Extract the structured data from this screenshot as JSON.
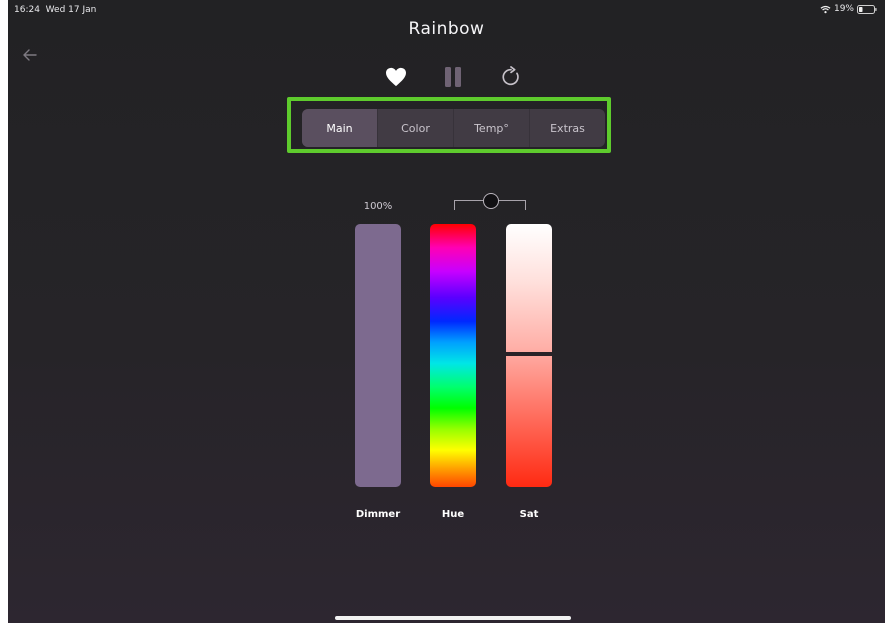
{
  "status": {
    "time": "16:24",
    "date": "Wed 17 Jan",
    "battery": "19%"
  },
  "header": {
    "title": "Rainbow"
  },
  "controls": {
    "favorite_icon": "heart-icon",
    "pause_icon": "pause-icon",
    "reload_icon": "reload-icon"
  },
  "tabs": [
    {
      "label": "Main",
      "active": true
    },
    {
      "label": "Color",
      "active": false
    },
    {
      "label": "Temp°",
      "active": false
    },
    {
      "label": "Extras",
      "active": false
    }
  ],
  "dimmer": {
    "label": "Dimmer",
    "value_text": "100%",
    "value": 1.0,
    "color": "#7d6a8f"
  },
  "hue": {
    "label": "Hue"
  },
  "sat": {
    "label": "Sat",
    "level": 0.49
  },
  "colors": {
    "accent_highlight": "#5ecb2d",
    "segment_bg": "#413b44",
    "segment_active": "#5a4f5f"
  }
}
